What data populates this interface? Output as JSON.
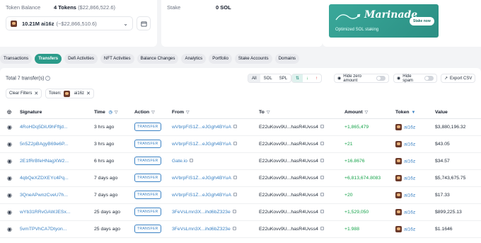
{
  "overview": {
    "token_balance_label": "Token Balance",
    "token_balance_value": "4 Tokens",
    "token_balance_usd": "($22,866,522.6)",
    "selected_token": "10.21M ai16z",
    "selected_token_usd": "(~$22,866,510.6)",
    "stake_label": "Stake",
    "stake_value": "0 SOL"
  },
  "banner": {
    "brand": "Marinade",
    "tagline": "Optimized SOL staking",
    "cta": "Stake now"
  },
  "tabs": [
    "Transactions",
    "Transfers",
    "Defi Activities",
    "NFT Activities",
    "Balance Changes",
    "Analytics",
    "Portfolio",
    "Stake Accounts",
    "Domains"
  ],
  "active_tab": "Transfers",
  "toolbar": {
    "total_text": "Total 7 transfer(s)",
    "filter_all": "All",
    "filter_sol": "SOL",
    "filter_spl": "SPL",
    "hide_zero": "Hide zero amount",
    "hide_spam": "Hide spam",
    "export": "Export CSV",
    "clear_filters": "Clear Filters",
    "token_chip_label": "Token:",
    "token_chip_value": "ai16z"
  },
  "table": {
    "headers": [
      "Signature",
      "Time",
      "Action",
      "From",
      "To",
      "Amount",
      "Token",
      "Value"
    ],
    "rows": [
      {
        "sig": "4RoHDq5DiU9hFftjd...",
        "time": "3 hrs ago",
        "action": "TRANSFER",
        "from": "wVbrpFiS1Z...eJGgh4BYuA",
        "to": "E22uKovv9U...hasR4Uvss4",
        "amount": "+1,865,479",
        "token": "ai16z",
        "value": "$3,880,196.32"
      },
      {
        "sig": "5n5Z2pBAgyB69e6P...",
        "time": "3 hrs ago",
        "action": "TRANSFER",
        "from": "wVbrpFiS1Z...eJGgh4BYuA",
        "to": "E22uKovv9U...hasR4Uvss4",
        "amount": "+21",
        "token": "ai16z",
        "value": "$43.05"
      },
      {
        "sig": "2E1fRrBfeHNagXW2...",
        "time": "6 hrs ago",
        "action": "TRANSFER",
        "from": "Gate.io",
        "to": "E22uKovv9U...hasR4Uvss4",
        "amount": "+16.8676",
        "token": "ai16z",
        "value": "$34.57"
      },
      {
        "sig": "4qbQeXZDXEYc4Pq...",
        "time": "7 days ago",
        "action": "TRANSFER",
        "from": "wVbrpFiS1Z...eJGgh4BYuA",
        "to": "E22uKovv9U...hasR4Uvss4",
        "amount": "+6,813,674.8083",
        "token": "ai16z",
        "value": "$5,743,675.75"
      },
      {
        "sig": "3QneAPwnzCveU7h...",
        "time": "7 days ago",
        "action": "TRANSFER",
        "from": "wVbrpFiS1Z...eJGgh4BYuA",
        "to": "E22uKovv9U...hasR4Uvss4",
        "amount": "+20",
        "token": "ai16z",
        "value": "$17.33"
      },
      {
        "sig": "wYb31RRvGAWJESx...",
        "time": "25 days ago",
        "action": "TRANSFER",
        "from": "3FeVsLmn3X...ihd6bZ323e",
        "to": "E22uKovv9U...hasR4Uvss4",
        "amount": "+1,529,050",
        "token": "ai16z",
        "value": "$899,225.13"
      },
      {
        "sig": "5vmTPVhCA7Dtyon...",
        "time": "25 days ago",
        "action": "TRANSFER",
        "from": "3FeVsLmn3X...ihd6bZ323e",
        "to": "E22uKovv9U...hasR4Uvss4",
        "amount": "+1.988",
        "token": "ai16z",
        "value": "$1.1646"
      }
    ]
  },
  "colors": {
    "accent": "#2b9b8a",
    "link": "#3b82c4",
    "positive": "#16a34a"
  }
}
